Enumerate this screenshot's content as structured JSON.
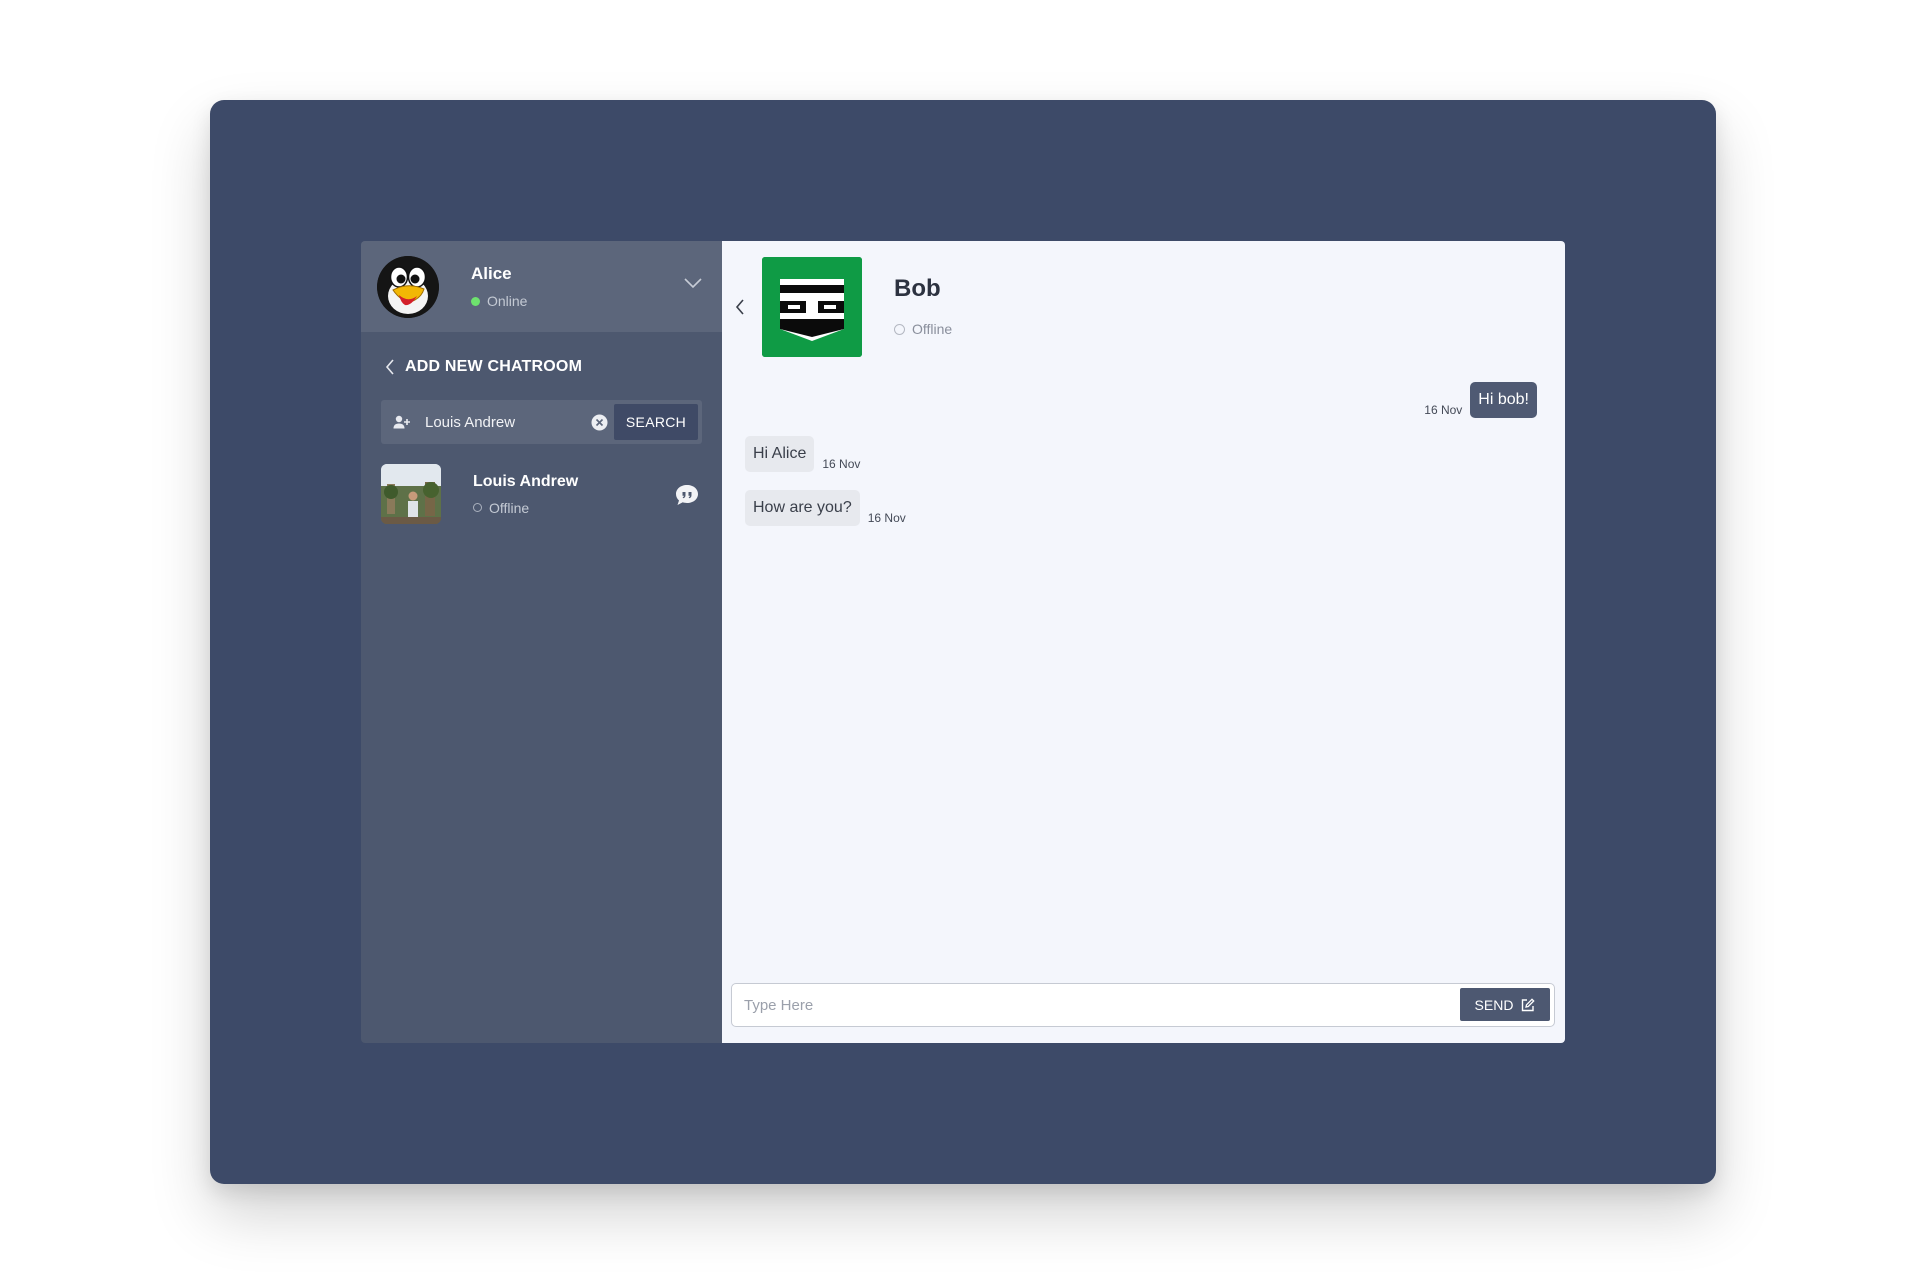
{
  "me": {
    "name": "Alice",
    "status": "Online"
  },
  "sidebar": {
    "add_chatroom_label": "ADD NEW CHATROOM",
    "search": {
      "value": "Louis Andrew",
      "button_label": "SEARCH"
    },
    "results": [
      {
        "name": "Louis Andrew",
        "status": "Offline"
      }
    ]
  },
  "chat": {
    "contact_name": "Bob",
    "contact_status": "Offline",
    "messages": [
      {
        "direction": "out",
        "text": "Hi bob!",
        "time": "16 Nov"
      },
      {
        "direction": "in",
        "text": "Hi Alice",
        "time": "16 Nov"
      },
      {
        "direction": "in",
        "text": "How are you?",
        "time": "16 Nov"
      }
    ],
    "composer": {
      "placeholder": "Type Here",
      "send_label": "SEND"
    }
  },
  "icons": {
    "me_avatar": "penguin-avatar",
    "dropdown": "chevron-down-icon",
    "back": "chevron-left-icon",
    "add_user": "user-plus-icon",
    "clear": "clear-icon",
    "open_chat": "chat-bubble-icon",
    "send": "edit-icon"
  },
  "colors": {
    "frame": "#3d4a68",
    "sidebar": "#4d586f",
    "chat_background": "#f4f6fc",
    "online": "#6ee26e",
    "bob_avatar": "#0f9b45"
  }
}
